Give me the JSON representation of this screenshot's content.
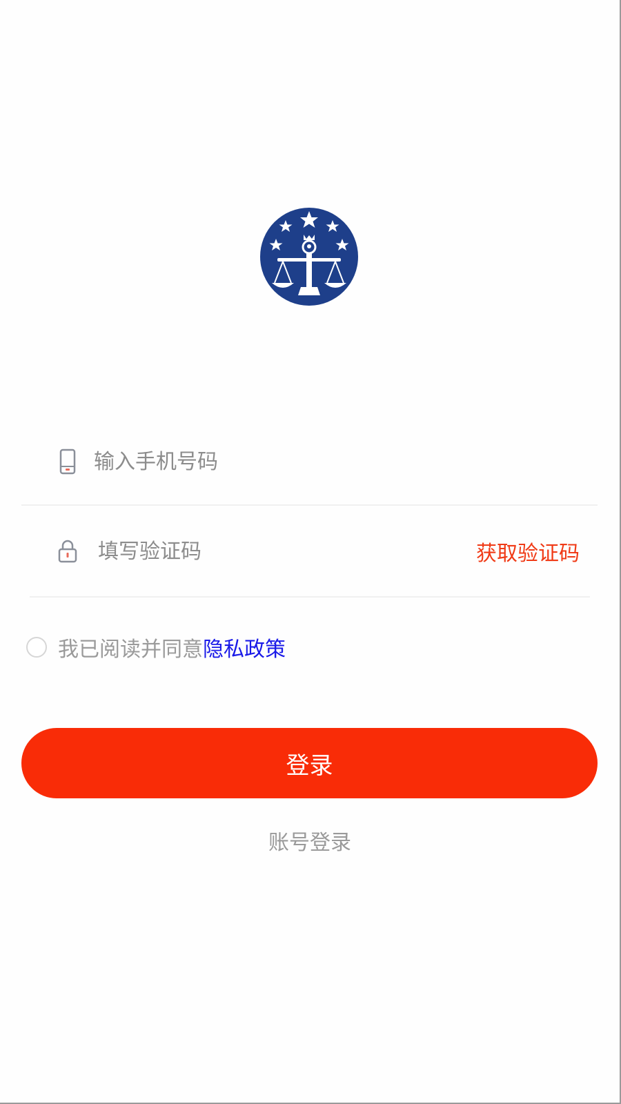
{
  "logo": {
    "icon": "scales-of-justice-emblem-icon",
    "background_color": "#1e3f8a"
  },
  "phone_field": {
    "icon": "mobile-phone-icon",
    "placeholder": "输入手机号码",
    "value": ""
  },
  "code_field": {
    "icon": "lock-icon",
    "placeholder": "填写验证码",
    "value": "",
    "get_code_label": "获取验证码"
  },
  "agreement": {
    "checked": false,
    "text": "我已阅读并同意",
    "link_text": "隐私政策"
  },
  "login_button": {
    "label": "登录"
  },
  "account_login": {
    "label": "账号登录"
  },
  "colors": {
    "accent": "#f92c07",
    "get_code": "#f03a16",
    "link": "#1a1ae8",
    "muted_text": "#9a9a9a",
    "divider": "#f0f0f0"
  }
}
